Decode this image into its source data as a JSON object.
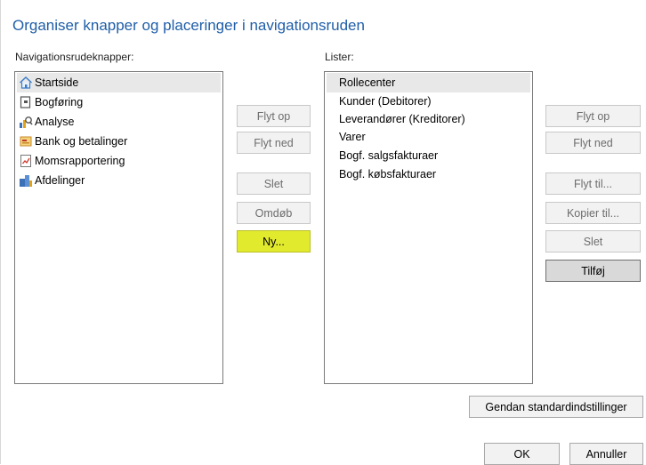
{
  "dialog": {
    "title": "Organiser knapper og placeringer i navigationsruden"
  },
  "left": {
    "label": "Navigationsrudeknapper:",
    "items": [
      {
        "label": "Startside",
        "icon": "home-icon",
        "selected": true
      },
      {
        "label": "Bogføring",
        "icon": "ledger-icon"
      },
      {
        "label": "Analyse",
        "icon": "analysis-icon"
      },
      {
        "label": "Bank og betalinger",
        "icon": "bank-icon"
      },
      {
        "label": "Momsrapportering",
        "icon": "report-icon"
      },
      {
        "label": "Afdelinger",
        "icon": "departments-icon"
      }
    ],
    "buttons": {
      "move_up": "Flyt op",
      "move_down": "Flyt ned",
      "delete": "Slet",
      "rename": "Omdøb",
      "new": "Ny..."
    }
  },
  "right": {
    "label": "Lister:",
    "items": [
      {
        "label": "Rollecenter",
        "selected": true
      },
      {
        "label": "Kunder (Debitorer)"
      },
      {
        "label": "Leverandører (Kreditorer)"
      },
      {
        "label": "Varer"
      },
      {
        "label": "Bogf. salgsfakturaer"
      },
      {
        "label": "Bogf. købsfakturaer"
      }
    ],
    "buttons": {
      "move_up": "Flyt op",
      "move_down": "Flyt ned",
      "move_to": "Flyt til...",
      "copy_to": "Kopier til...",
      "delete": "Slet",
      "add": "Tilføj"
    }
  },
  "footer": {
    "restore": "Gendan standardindstillinger",
    "ok": "OK",
    "cancel": "Annuller"
  },
  "colors": {
    "title": "#1f5ea8",
    "highlight_button": "#e2ea2e",
    "selected_row": "#e8e8e8"
  }
}
